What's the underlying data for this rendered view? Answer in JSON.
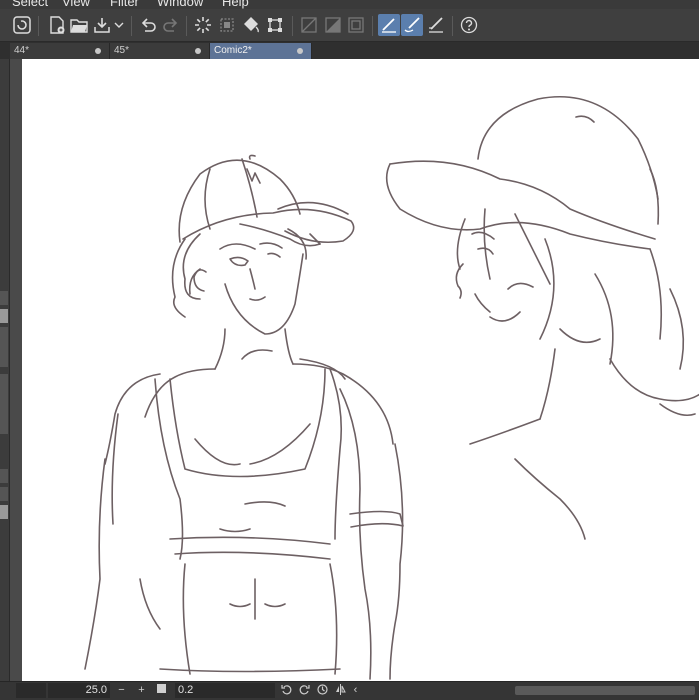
{
  "menu": {
    "items": [
      "Select",
      "View",
      "Filter",
      "Window",
      "Help"
    ]
  },
  "toolbar": {
    "buttons": [
      "app-icon",
      "new-icon",
      "open-icon",
      "save-icon",
      "dropdown-icon",
      "undo-icon",
      "redo-icon",
      "loading-icon",
      "selection-icon",
      "fill-icon",
      "transform-icon",
      "grid-off-icon",
      "grid-half-icon",
      "frame-icon",
      "pen-straight-icon",
      "pen-curve-icon",
      "pen-ruler-icon",
      "help-icon"
    ]
  },
  "tabs": [
    {
      "label": "44*",
      "active": false
    },
    {
      "label": "45*",
      "active": false
    },
    {
      "label": "Comic2*",
      "active": true
    }
  ],
  "status": {
    "zoom": "25.0",
    "zoom_minus": "−",
    "zoom_plus": "+",
    "angle": "0.2",
    "scroll_left": "‹"
  },
  "colors": {
    "active_tab": "#5d7396",
    "active_tool": "#5b7fae",
    "sketch_line": "#6d6063"
  }
}
